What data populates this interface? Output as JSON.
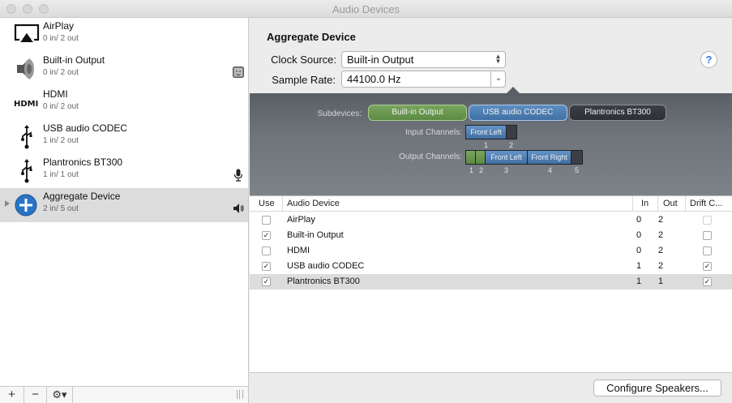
{
  "window": {
    "title": "Audio Devices"
  },
  "sidebar": {
    "devices": [
      {
        "name": "AirPlay",
        "io": "0 in/ 2 out",
        "icon": "airplay-icon"
      },
      {
        "name": "Built-in Output",
        "io": "0 in/ 2 out",
        "icon": "speaker-icon",
        "badge": "finder-icon"
      },
      {
        "name": "HDMI",
        "io": "0 in/ 2 out",
        "icon": "hdmi-icon"
      },
      {
        "name": "USB audio CODEC",
        "io": "1 in/ 2 out",
        "icon": "usb-icon"
      },
      {
        "name": "Plantronics BT300",
        "io": "1 in/ 1 out",
        "icon": "usb-icon",
        "badge": "microphone-icon"
      },
      {
        "name": "Aggregate Device",
        "io": "2 in/ 5 out",
        "icon": "aggregate-plus-icon",
        "badge": "volume-icon",
        "selected": true
      }
    ],
    "bottom": {
      "add": "+",
      "remove": "−",
      "gear": "⚙▾"
    }
  },
  "detail": {
    "title": "Aggregate Device",
    "clock_source_label": "Clock Source:",
    "clock_source_value": "Built-in Output",
    "sample_rate_label": "Sample Rate:",
    "sample_rate_value": "44100.0 Hz",
    "help": "?"
  },
  "subdevices": {
    "label": "Subdevices:",
    "items": [
      "Built-in Output",
      "USB audio CODEC",
      "Plantronics BT300"
    ],
    "input_label": "Input Channels:",
    "input_channel_names": [
      "Front Left"
    ],
    "input_numbers": [
      "1",
      "2"
    ],
    "output_label": "Output Channels:",
    "output_channel_names": [
      "Front Left",
      "Front Right"
    ],
    "output_numbers": [
      "1",
      "2",
      "3",
      "4",
      "5"
    ]
  },
  "table": {
    "headers": [
      "Use",
      "Audio Device",
      "In",
      "Out",
      "Drift C..."
    ],
    "rows": [
      {
        "use": false,
        "device": "AirPlay",
        "in": "0",
        "out": "2",
        "drift": false,
        "drift_disabled": true
      },
      {
        "use": true,
        "device": "Built-in Output",
        "in": "0",
        "out": "2",
        "drift": false
      },
      {
        "use": false,
        "device": "HDMI",
        "in": "0",
        "out": "2",
        "drift": false
      },
      {
        "use": true,
        "device": "USB audio CODEC",
        "in": "1",
        "out": "2",
        "drift": true
      },
      {
        "use": true,
        "device": "Plantronics BT300",
        "in": "1",
        "out": "1",
        "drift": true,
        "selected": true
      }
    ]
  },
  "footer": {
    "configure_label": "Configure Speakers..."
  }
}
